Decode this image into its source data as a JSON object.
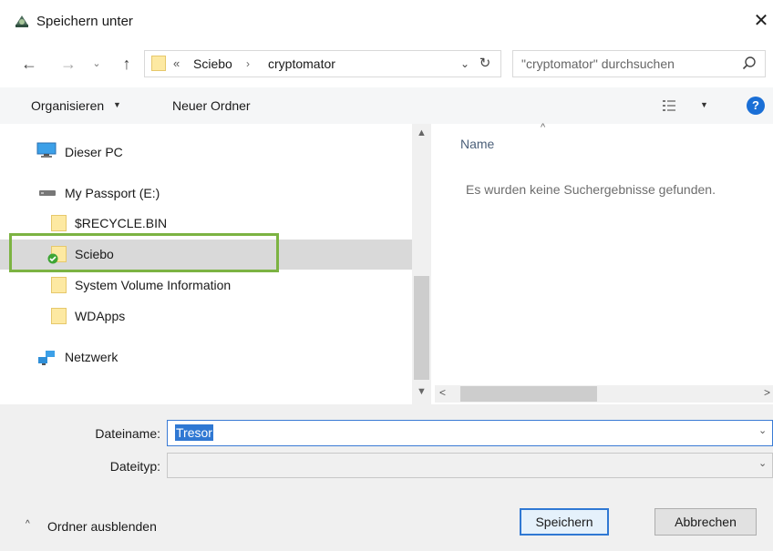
{
  "window": {
    "title": "Speichern unter",
    "close_glyph": "✕",
    "icon": "cryptomator-icon"
  },
  "nav": {
    "back": "←",
    "forward": "→",
    "recent": "⌄",
    "up": "↑",
    "breadcrumb_prefix": "«",
    "breadcrumbs": [
      "Sciebo",
      "cryptomator"
    ],
    "separator": "›",
    "dropdown": "⌄",
    "refresh": "↻",
    "search_placeholder": "\"cryptomator\" durchsuchen"
  },
  "toolbar": {
    "organize_label": "Organisieren",
    "organize_caret": "▼",
    "new_folder_label": "Neuer Ordner",
    "view_caret": "▼",
    "help_label": "?"
  },
  "tree": {
    "items": [
      {
        "label": "Dieser PC",
        "icon": "pc-icon"
      },
      {
        "label": "My Passport (E:)",
        "icon": "drive-icon"
      },
      {
        "label": "$RECYCLE.BIN",
        "icon": "folder-icon"
      },
      {
        "label": "Sciebo",
        "icon": "folder-sync-icon",
        "selected": true
      },
      {
        "label": "System Volume Information",
        "icon": "folder-icon"
      },
      {
        "label": "WDApps",
        "icon": "folder-icon"
      },
      {
        "label": "Netzwerk",
        "icon": "network-icon"
      }
    ]
  },
  "content": {
    "column_name": "Name",
    "sort_arrow": "^",
    "empty_message": "Es wurden keine Suchergebnisse gefunden."
  },
  "form": {
    "filename_label": "Dateiname:",
    "filename_value": "Tresor",
    "filetype_label": "Dateityp:",
    "filetype_value": "",
    "combo_caret": "⌄"
  },
  "footer": {
    "hide_folders_label": "Ordner ausblenden",
    "hide_caret": "^",
    "save_label": "Speichern",
    "cancel_label": "Abbrechen"
  },
  "colors": {
    "highlight_border": "#7cb342",
    "selection_bg": "#2f78d3",
    "help_blue": "#1a6fd6"
  }
}
